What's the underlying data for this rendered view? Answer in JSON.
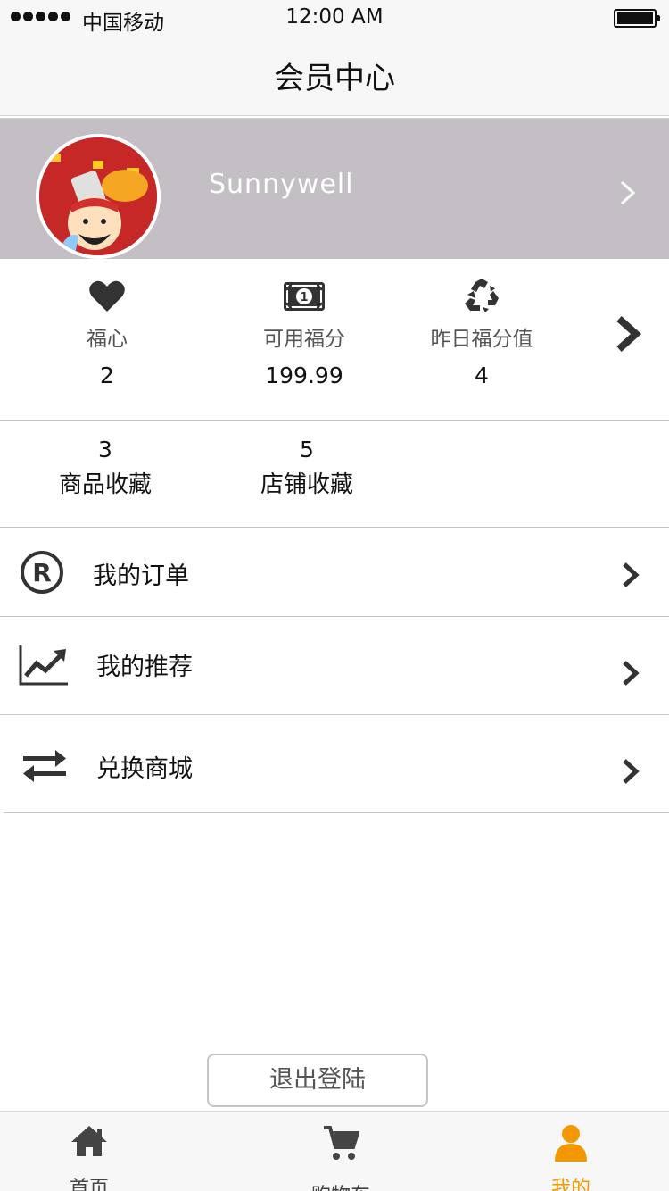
{
  "status_bar": {
    "carrier": "中国移动",
    "time": "12:00 AM"
  },
  "nav": {
    "title": "会员中心"
  },
  "profile": {
    "username": "Sunnywell"
  },
  "stats": [
    {
      "icon": "heart-icon",
      "label": "福心",
      "value": "2"
    },
    {
      "icon": "money-bill-icon",
      "label": "可用福分",
      "value": "199.99"
    },
    {
      "icon": "recycle-icon",
      "label": "昨日福分值",
      "value": "4"
    }
  ],
  "favorites": [
    {
      "count": "3",
      "label": "商品收藏"
    },
    {
      "count": "5",
      "label": "店铺收藏"
    }
  ],
  "menu": [
    {
      "icon": "registered-icon",
      "label": "我的订单"
    },
    {
      "icon": "line-chart-icon",
      "label": "我的推荐"
    },
    {
      "icon": "exchange-icon",
      "label": "兑换商城"
    }
  ],
  "logout_label": "退出登陆",
  "tabs": [
    {
      "icon": "home-icon",
      "label": "首页",
      "active": false
    },
    {
      "icon": "cart-icon",
      "label": "购物车",
      "active": false
    },
    {
      "icon": "user-icon",
      "label": "我的",
      "active": true
    }
  ],
  "colors": {
    "accent": "#f39800",
    "profile_bg": "#c3bfc4",
    "icon": "#333333"
  }
}
